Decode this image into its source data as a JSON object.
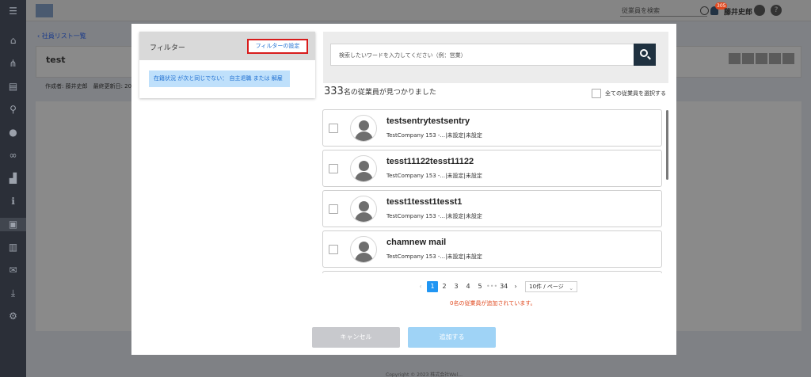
{
  "topbar": {
    "search_placeholder": "従業員を検索",
    "notification_count": "305",
    "user_name": "藤井史郎",
    "help_label": "?"
  },
  "background": {
    "back_link": "‹ 社員リスト一覧",
    "title": "test",
    "meta": "作成者: 藤井史郎　最終更新日: 20",
    "footer": "Copyright © 2023 株式会社Wel..."
  },
  "filter": {
    "title": "フィルター",
    "settings_button": "フィルターの設定",
    "chip": "在籍状況 が次と同じでない： 自主退職 または 解雇"
  },
  "search": {
    "placeholder": "検索したいワードを入力してください（例：営業）"
  },
  "results": {
    "count": "333",
    "count_suffix": "名の従業員が見つかりました",
    "select_all_label": "全ての従業員を選択する"
  },
  "employees": [
    {
      "name": "testsentrytestsentry",
      "sub": "TestCompany 153 -...|未設定|未設定"
    },
    {
      "name": "tesst11122tesst11122",
      "sub": "TestCompany 153 -...|未設定|未設定"
    },
    {
      "name": "tesst1tesst1tesst1",
      "sub": "TestCompany 153 -...|未設定|未設定"
    },
    {
      "name": "chamnew mail",
      "sub": "TestCompany 153 -...|未設定|未設定"
    }
  ],
  "pagination": {
    "prev": "‹",
    "pages": [
      "1",
      "2",
      "3",
      "4",
      "5",
      "•••",
      "34"
    ],
    "next": "›",
    "page_size": "10件 / ページ",
    "page_size_chevron": "⌄"
  },
  "added_message": "0名の従業員が追加されています。",
  "buttons": {
    "cancel": "キャンセル",
    "add": "追加する"
  },
  "colors": {
    "primary": "#2196f3",
    "alert": "#e0491f",
    "highlight_border": "#d81c1c",
    "search_button": "#1f3140"
  }
}
